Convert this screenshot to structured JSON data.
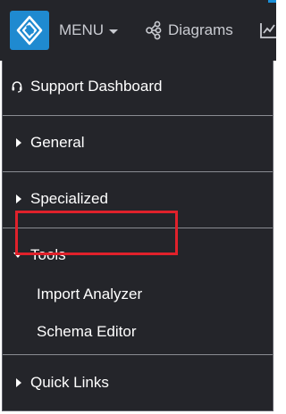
{
  "topbar": {
    "menu_label": "MENU",
    "diagrams_label": "Diagrams"
  },
  "menu": {
    "support_dashboard": "Support Dashboard",
    "general": "General",
    "specialized": "Specialized",
    "tools": "Tools",
    "tools_items": [
      "Import Analyzer",
      "Schema Editor"
    ],
    "quick_links": "Quick Links"
  },
  "highlight": {
    "target": "Import Analyzer",
    "color": "#e0212b"
  },
  "colors": {
    "topbar_bg": "#24252a",
    "logo_bg": "#1f8ad0",
    "menu_text": "#ffffff",
    "topbar_text": "#c9cbd1"
  },
  "icons": {
    "logo": "diamond-logo-icon",
    "menu_caret": "caret-down-icon",
    "diagrams": "diagram-nodes-icon",
    "chart": "chart-icon",
    "support": "headset-icon",
    "collapsed": "triangle-right-icon",
    "expanded": "triangle-down-icon"
  }
}
